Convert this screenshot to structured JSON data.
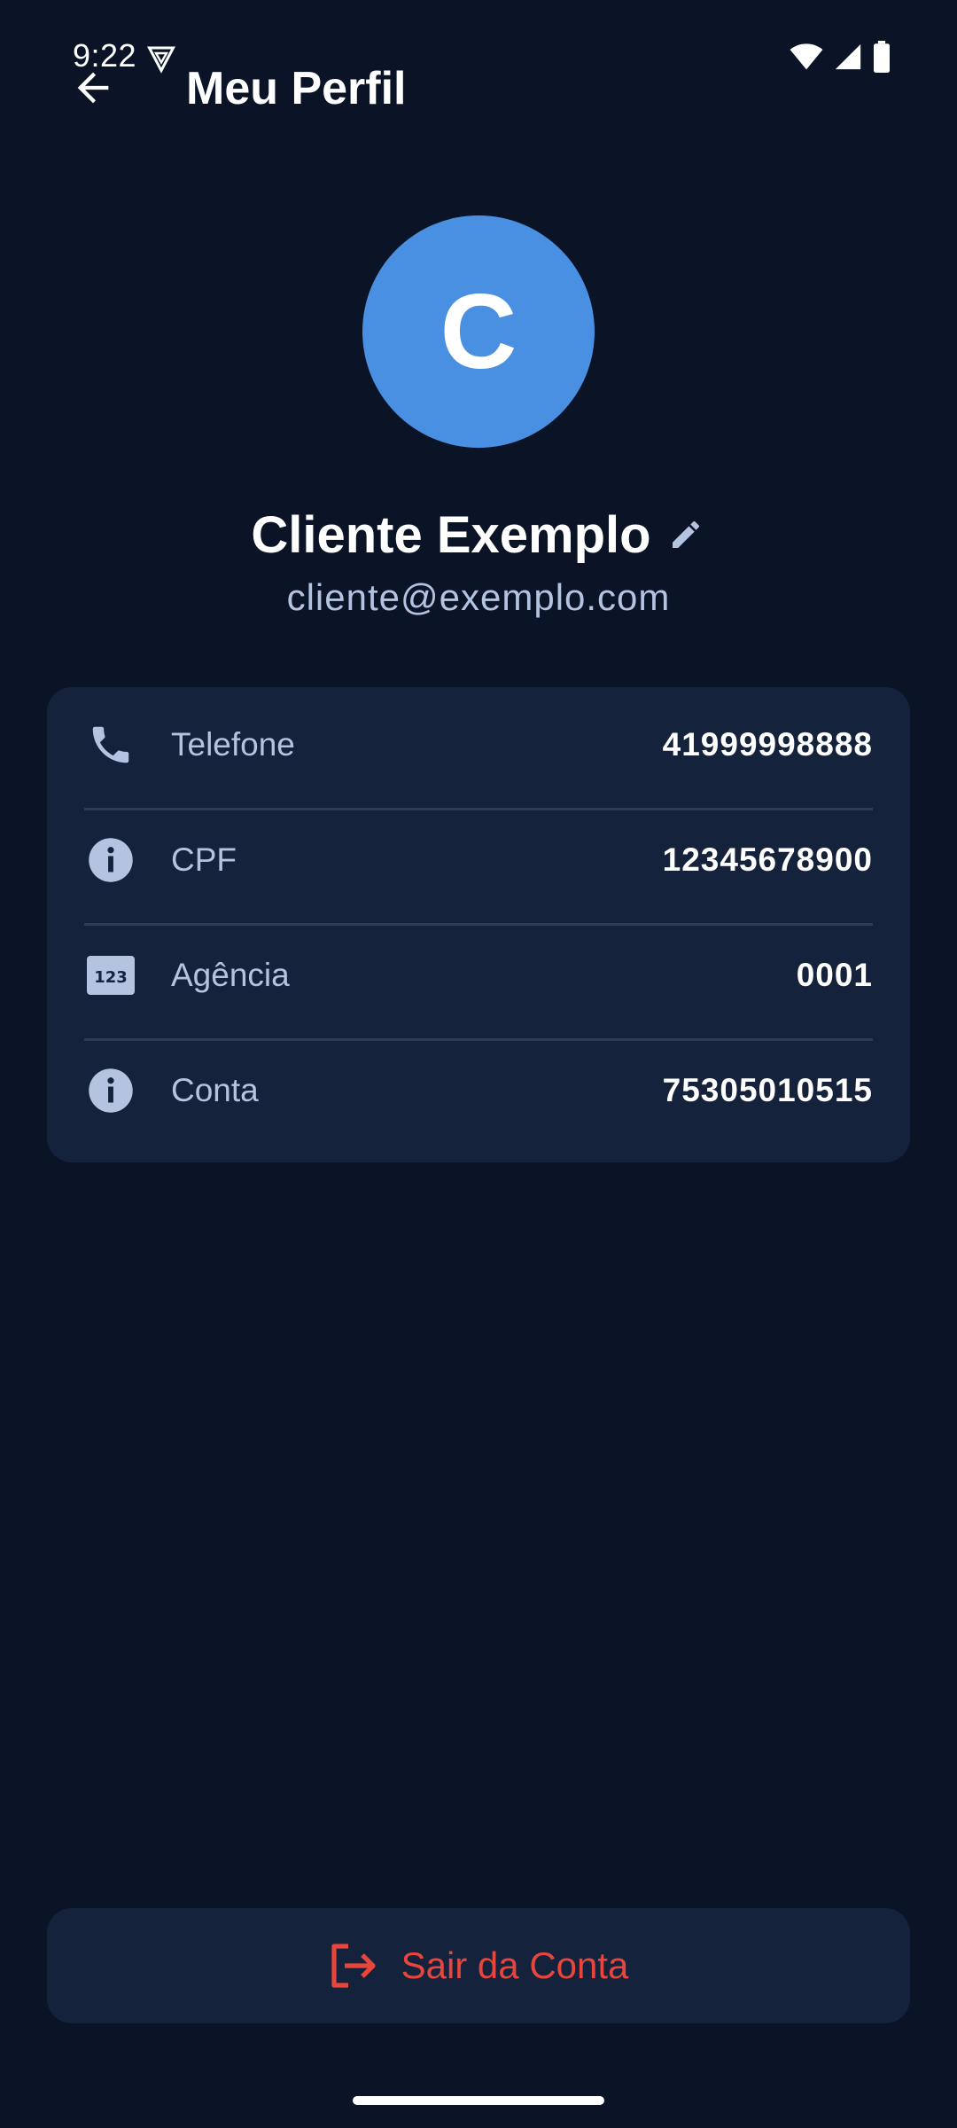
{
  "status_bar": {
    "time": "9:22"
  },
  "app_bar": {
    "title": "Meu Perfil",
    "back_icon": "arrow-back-icon"
  },
  "profile": {
    "avatar_initial": "C",
    "avatar_color": "#4a90e2",
    "name": "Cliente Exemplo",
    "email": "cliente@exemplo.com"
  },
  "info_rows": [
    {
      "icon": "phone-icon",
      "label": "Telefone",
      "value": "41999998888"
    },
    {
      "icon": "info-icon",
      "label": "CPF",
      "value": "12345678900"
    },
    {
      "icon": "numbers-icon",
      "label": "Agência",
      "value": "0001"
    },
    {
      "icon": "info-icon",
      "label": "Conta",
      "value": "75305010515"
    }
  ],
  "logout": {
    "label": "Sair da Conta",
    "color": "#e8463c"
  },
  "colors": {
    "background": "#0b1427",
    "card": "#15223c",
    "muted_text": "#b3c3e0"
  }
}
